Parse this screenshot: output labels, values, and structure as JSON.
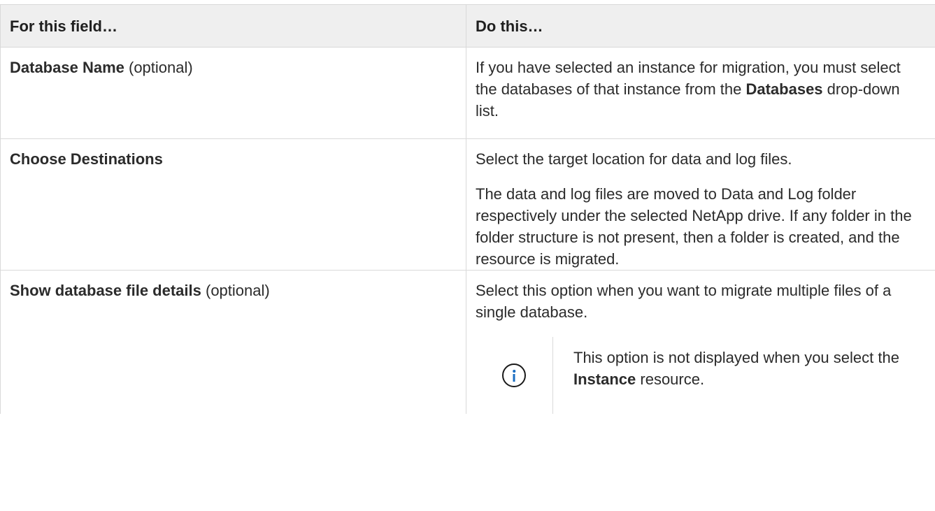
{
  "table": {
    "header": {
      "col1": "For this field…",
      "col2": "Do this…"
    },
    "rows": [
      {
        "field": "Database Name",
        "field_suffix": " (optional)",
        "desc1_pre": "If you have selected an instance for migration, you must select the databases of that instance from the ",
        "desc1_bold": "Databases",
        "desc1_post": " drop-down list."
      },
      {
        "field": "Choose Destinations",
        "desc1": "Select the target location for data and log files.",
        "desc2": "The data and log files are moved to Data and Log folder respectively under the selected NetApp drive. If any folder in the folder structure is not present, then a folder is created, and the resource is migrated."
      },
      {
        "field": "Show database file details",
        "field_suffix": " (optional)",
        "desc1": "Select this option when you want to migrate multiple files of a single database.",
        "note": {
          "icon": "info-icon",
          "pre": "This option is not displayed when you select the ",
          "bold": "Instance",
          "post": " resource."
        }
      }
    ]
  }
}
